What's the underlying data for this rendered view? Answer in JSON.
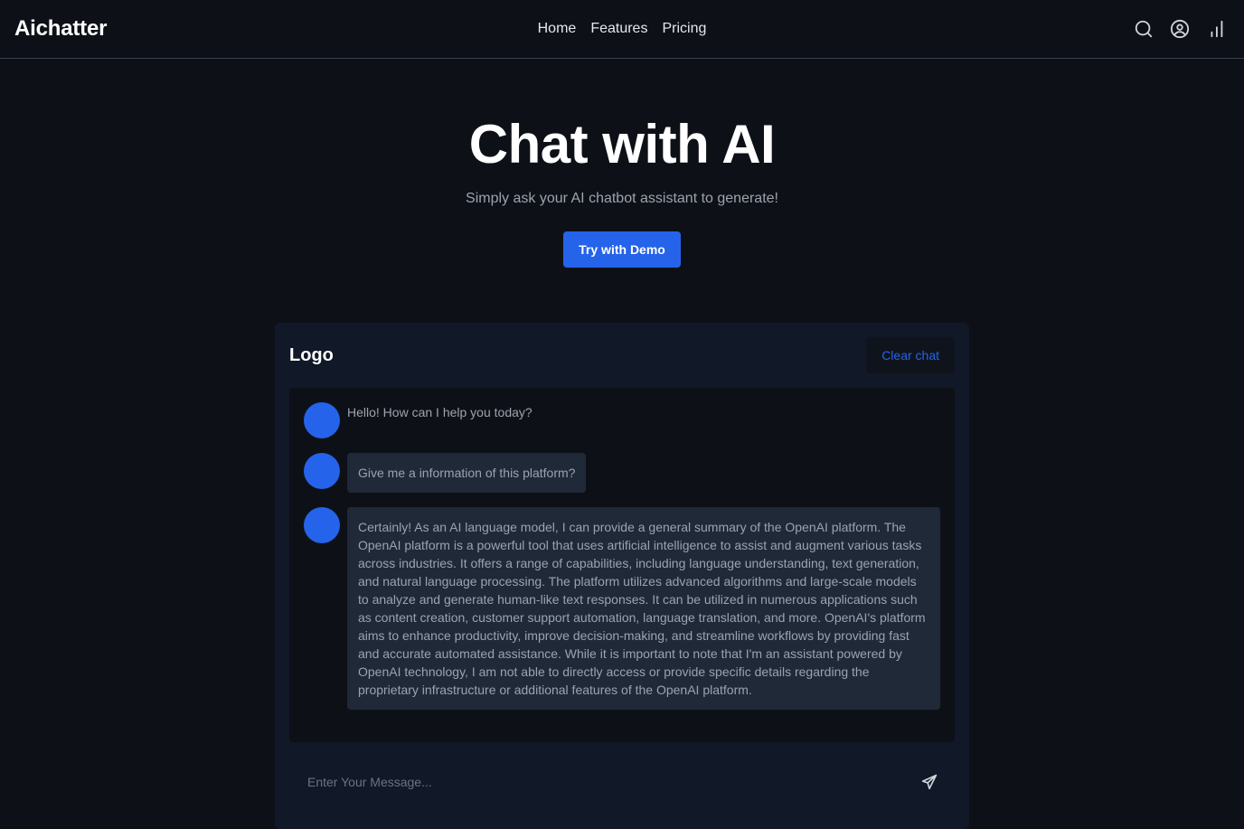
{
  "nav": {
    "brand": "Aichatter",
    "links": [
      "Home",
      "Features",
      "Pricing"
    ],
    "icons": [
      "search-icon",
      "user-circle-icon",
      "bar-chart-icon"
    ]
  },
  "hero": {
    "title": "Chat with AI",
    "subtitle": "Simply ask your AI chatbot assistant to generate!",
    "cta_label": "Try with Demo"
  },
  "chat": {
    "logo": "Logo",
    "clear_label": "Clear chat",
    "messages": [
      {
        "text": "Hello! How can I help you today?"
      },
      {
        "text": "Give me a information of this platform?"
      },
      {
        "text": "Certainly! As an AI language model, I can provide a general summary of the OpenAI platform. The OpenAI platform is a powerful tool that uses artificial intelligence to assist and augment various tasks across industries. It offers a range of capabilities, including language understanding, text generation, and natural language processing. The platform utilizes advanced algorithms and large-scale models to analyze and generate human-like text responses. It can be utilized in numerous applications such as content creation, customer support automation, language translation, and more. OpenAI's platform aims to enhance productivity, improve decision-making, and streamline workflows by providing fast and accurate automated assistance. While it is important to note that I'm an assistant powered by OpenAI technology, I am not able to directly access or provide specific details regarding the proprietary infrastructure or additional features of the OpenAI platform."
      }
    ],
    "input_placeholder": "Enter Your Message...",
    "send_icon": "paper-plane-icon"
  },
  "colors": {
    "background": "#0d1117",
    "card": "#111827",
    "bubble": "#1f2937",
    "accent": "#2563eb"
  }
}
